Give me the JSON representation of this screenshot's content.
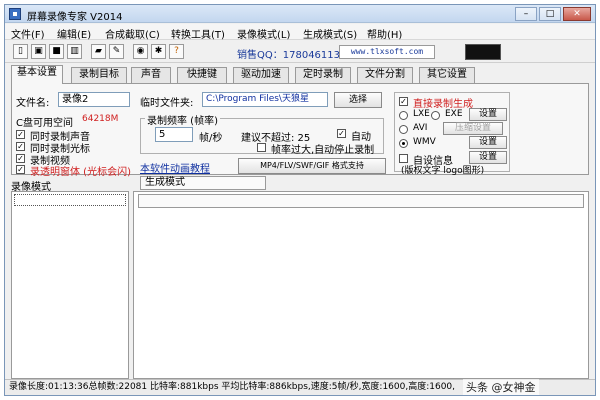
{
  "window": {
    "title": "屏幕录像专家 V2014"
  },
  "menu": [
    "文件(F)",
    "编辑(E)",
    "合成截取(C)",
    "转换工具(T)",
    "录像模式(L)",
    "生成模式(S)",
    "帮助(H)"
  ],
  "toolbar": {
    "qq": "销售QQ：178046113",
    "site": "www.tlxsoft.com",
    "icons": [
      "new-icon",
      "record-icon",
      "stop-icon",
      "pause-icon",
      "folder-icon",
      "tools-icon",
      "globe-icon",
      "gift-icon",
      "help-icon"
    ]
  },
  "tabs": [
    "基本设置",
    "录制目标",
    "声音",
    "快捷键",
    "驱动加速",
    "定时录制",
    "文件分割",
    "其它设置"
  ],
  "basic": {
    "filename_label": "文件名:",
    "filename_value": "录像2",
    "temp_label": "临时文件夹:",
    "temp_value": "C:\\Program Files\\天狼星",
    "browse_btn": "选择",
    "disk_label": "C盘可用空间",
    "disk_value": "64218M",
    "check_audio": "同时录制声音",
    "check_cursor": "同时录制光标",
    "check_video": "录制视频",
    "check_transparent": "录透明窗体 (光标会闪)",
    "fps_group": "录制频率 (帧率)",
    "fps_value": "5",
    "fps_unit": "帧/秒",
    "suggest": "建议不超过: 25",
    "auto": "自动",
    "auto_stop": "帧率过大,自动停止录制",
    "tutorial_link": "本软件动画教程",
    "format_btn": "MP4/FLV/SWF/GIF 格式支持",
    "direct_gen": "直接录制生成",
    "opt_lxe": "LXE",
    "opt_exe": "EXE",
    "opt_avi": "AVI",
    "opt_wmv": "WMV",
    "settings_btn": "设置",
    "compress_btn": "压缩设置",
    "custom_info": "自设信息",
    "copyright": "(版权文字 logo图形)"
  },
  "lower": {
    "mode_header": "录像模式",
    "gen_mode_tab": "生成模式"
  },
  "status": "录像长度:01:13:36总帧数:22081 比特率:881kbps 平均比特率:886kbps,速度:5帧/秒,宽度:1600,高度:1600,",
  "watermark": "头条 @女神金"
}
